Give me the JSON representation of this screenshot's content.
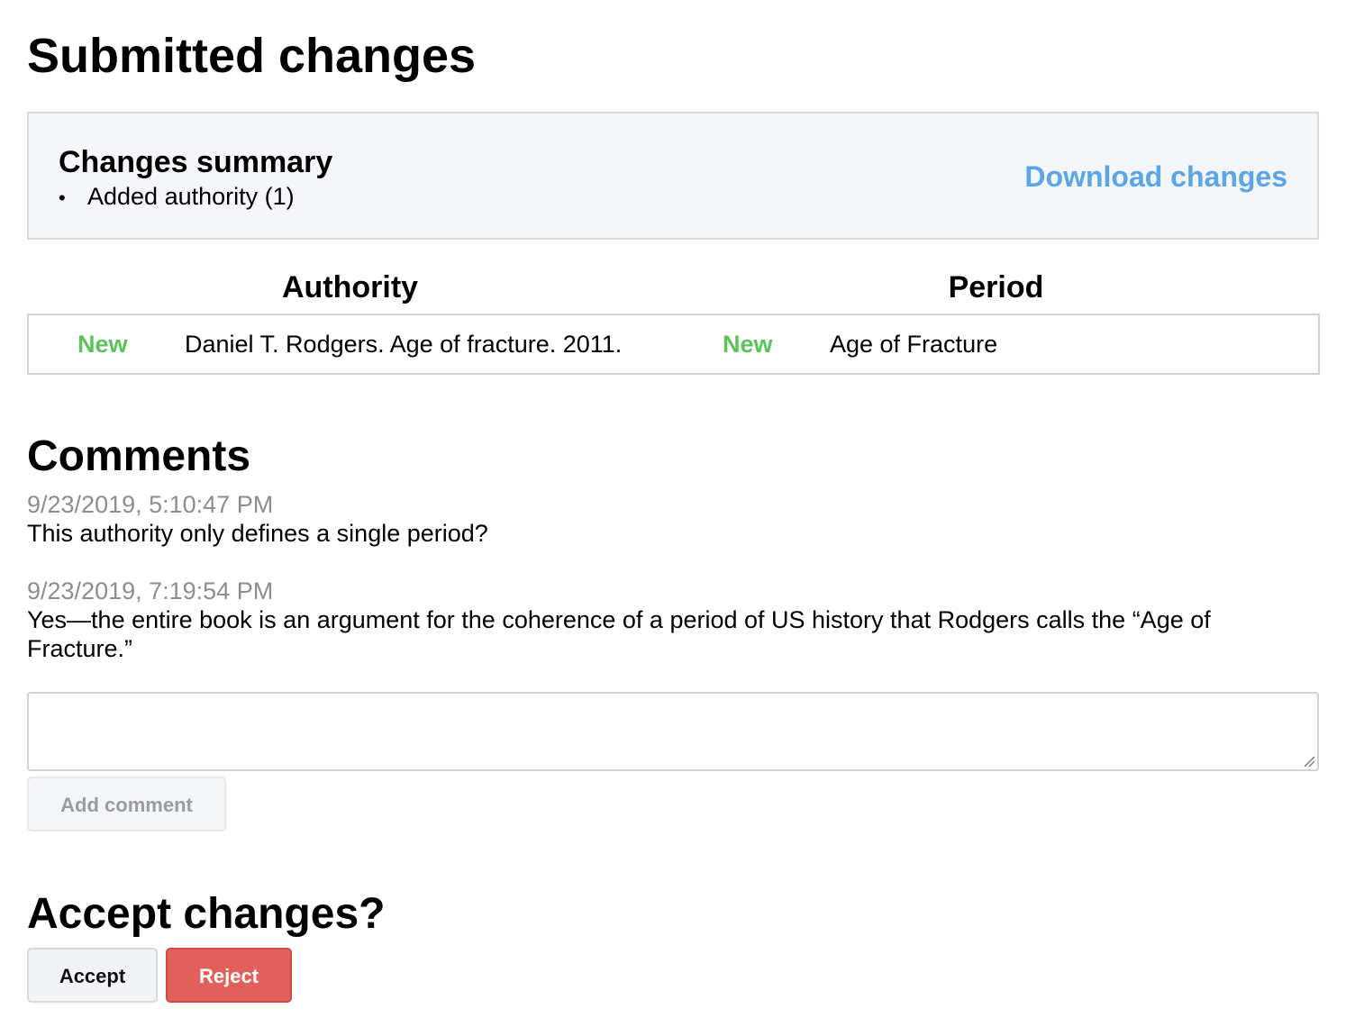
{
  "page": {
    "title": "Submitted changes"
  },
  "summary": {
    "title": "Changes summary",
    "items": [
      {
        "label": "Added authority (1)"
      }
    ],
    "download_label": "Download changes"
  },
  "changes_table": {
    "columns": [
      "Authority",
      "Period"
    ],
    "rows": [
      {
        "authority_status": "New",
        "authority_value": "Daniel T. Rodgers. Age of fracture. 2011.",
        "period_status": "New",
        "period_value": "Age of Fracture"
      }
    ]
  },
  "comments": {
    "heading": "Comments",
    "items": [
      {
        "timestamp": "9/23/2019, 5:10:47 PM",
        "text": "This authority only defines a single period?"
      },
      {
        "timestamp": "9/23/2019, 7:19:54 PM",
        "text": "Yes—the entire book is an argument for the coherence of a period of US history that Rodgers calls the “Age of Fracture.”"
      }
    ],
    "input_value": "",
    "add_comment_label": "Add comment"
  },
  "review": {
    "heading": "Accept changes?",
    "accept_label": "Accept",
    "reject_label": "Reject"
  },
  "colors": {
    "status_new": "#5cc35a",
    "link": "#5ba6e8",
    "reject": "#e2605b",
    "timestamp": "#8a8d93"
  }
}
